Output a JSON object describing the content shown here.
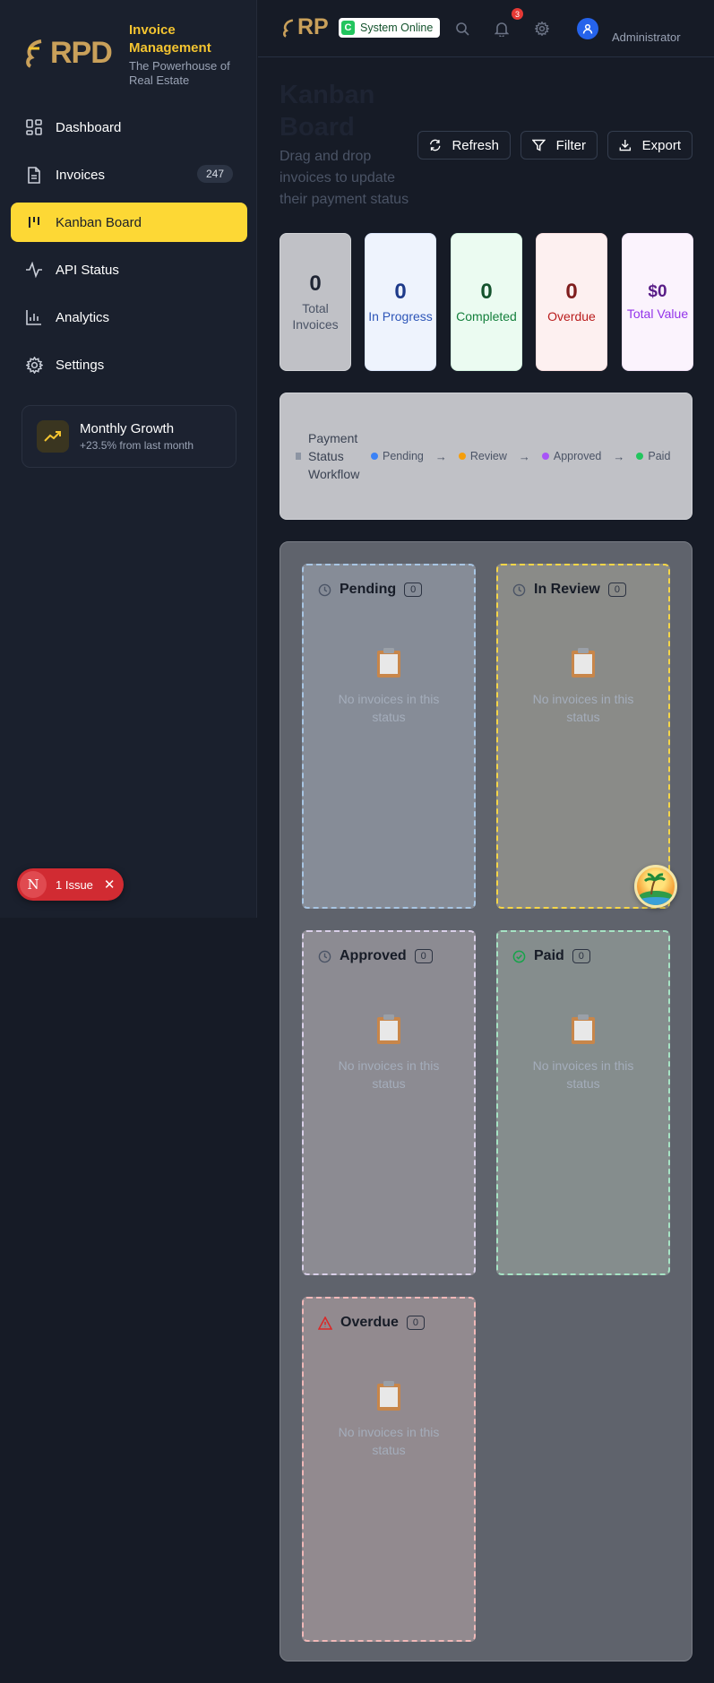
{
  "brand": {
    "logo_text": "RPD",
    "title": "Invoice Management",
    "subtitle": "The Powerhouse of Real Estate"
  },
  "sidebar": {
    "items": [
      {
        "label": "Dashboard",
        "icon": "dashboard-icon"
      },
      {
        "label": "Invoices",
        "icon": "invoice-icon",
        "count": "247"
      },
      {
        "label": "Kanban Board",
        "icon": "kanban-icon",
        "active": true
      },
      {
        "label": "API Status",
        "icon": "activity-icon"
      },
      {
        "label": "Analytics",
        "icon": "chart-icon"
      },
      {
        "label": "Settings",
        "icon": "gear-icon"
      }
    ],
    "growth": {
      "title": "Monthly Growth",
      "subtitle": "+23.5% from last month"
    },
    "issue": {
      "badge": "N",
      "label": "1 Issue"
    }
  },
  "header": {
    "logo_text": "RP",
    "status": "System Online",
    "status_badge": "C",
    "notifications": "3",
    "user": "Administrator"
  },
  "main": {
    "title": "Kanban Board",
    "subtitle": "Drag and drop invoices to update their payment status",
    "actions": {
      "refresh": "Refresh",
      "filter": "Filter",
      "export": "Export"
    },
    "stats": [
      {
        "value": "0",
        "label": "Total Invoices",
        "color": "#1e2433"
      },
      {
        "value": "0",
        "label": "In Progress",
        "color": "#1e3a8a"
      },
      {
        "value": "0",
        "label": "Completed",
        "color": "#14532d"
      },
      {
        "value": "0",
        "label": "Overdue",
        "color": "#7f1d1d"
      },
      {
        "value": "$0",
        "label": "Total Value",
        "color": "#581c87"
      }
    ],
    "workflow": {
      "title": "Payment Status Workflow",
      "steps": [
        {
          "label": "Pending",
          "color": "#3b82f6"
        },
        {
          "label": "Review",
          "color": "#f59e0b"
        },
        {
          "label": "Approved",
          "color": "#a855f7"
        },
        {
          "label": "Paid",
          "color": "#22c55e"
        }
      ]
    },
    "columns": [
      {
        "title": "Pending",
        "count": "0",
        "empty": "No invoices in this status"
      },
      {
        "title": "In Review",
        "count": "0",
        "empty": "No invoices in this status"
      },
      {
        "title": "Approved",
        "count": "0",
        "empty": "No invoices in this status"
      },
      {
        "title": "Paid",
        "count": "0",
        "empty": "No invoices in this status"
      },
      {
        "title": "Overdue",
        "count": "0",
        "empty": "No invoices in this status"
      }
    ]
  },
  "colors": {
    "accent": "#fdd835",
    "sidebar_bg": "#1a202d",
    "page_bg": "#161b26"
  }
}
